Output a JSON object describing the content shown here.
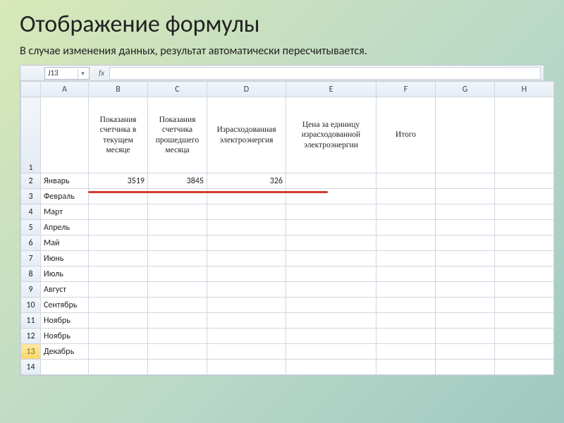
{
  "title": "Отображение формулы",
  "subtitle": "В случае изменения данных, результат автоматически пересчитывается.",
  "namebox": "J13",
  "fx_label": "fx",
  "columns": [
    "A",
    "B",
    "C",
    "D",
    "E",
    "F",
    "G",
    "H"
  ],
  "header_row_num": "1",
  "headers": {
    "A": "",
    "B": "Показания счетчика в текущем месяце",
    "C": "Показания счетчика прошедшего месяца",
    "D": "Израсходованная электроэнергия",
    "E": "Цена за единицу израсходованной электроэнергии",
    "F": "Итого",
    "G": "",
    "H": ""
  },
  "rows": [
    {
      "n": "2",
      "A": "Январь",
      "B": "3519",
      "C": "3845",
      "D": "326",
      "E": "",
      "F": "",
      "G": "",
      "H": ""
    },
    {
      "n": "3",
      "A": "Февраль",
      "B": "",
      "C": "",
      "D": "",
      "E": "",
      "F": "",
      "G": "",
      "H": ""
    },
    {
      "n": "4",
      "A": "Март",
      "B": "",
      "C": "",
      "D": "",
      "E": "",
      "F": "",
      "G": "",
      "H": ""
    },
    {
      "n": "5",
      "A": "Апрель",
      "B": "",
      "C": "",
      "D": "",
      "E": "",
      "F": "",
      "G": "",
      "H": ""
    },
    {
      "n": "6",
      "A": "Май",
      "B": "",
      "C": "",
      "D": "",
      "E": "",
      "F": "",
      "G": "",
      "H": ""
    },
    {
      "n": "7",
      "A": "Июнь",
      "B": "",
      "C": "",
      "D": "",
      "E": "",
      "F": "",
      "G": "",
      "H": ""
    },
    {
      "n": "8",
      "A": "Июль",
      "B": "",
      "C": "",
      "D": "",
      "E": "",
      "F": "",
      "G": "",
      "H": ""
    },
    {
      "n": "9",
      "A": "Август",
      "B": "",
      "C": "",
      "D": "",
      "E": "",
      "F": "",
      "G": "",
      "H": ""
    },
    {
      "n": "10",
      "A": "Сентябрь",
      "B": "",
      "C": "",
      "D": "",
      "E": "",
      "F": "",
      "G": "",
      "H": ""
    },
    {
      "n": "11",
      "A": "Ноябрь",
      "B": "",
      "C": "",
      "D": "",
      "E": "",
      "F": "",
      "G": "",
      "H": ""
    },
    {
      "n": "12",
      "A": "Ноябрь",
      "B": "",
      "C": "",
      "D": "",
      "E": "",
      "F": "",
      "G": "",
      "H": ""
    },
    {
      "n": "13",
      "A": "Декабрь",
      "B": "",
      "C": "",
      "D": "",
      "E": "",
      "F": "",
      "G": "",
      "H": "",
      "selected": true
    },
    {
      "n": "14",
      "A": "",
      "B": "",
      "C": "",
      "D": "",
      "E": "",
      "F": "",
      "G": "",
      "H": ""
    }
  ]
}
